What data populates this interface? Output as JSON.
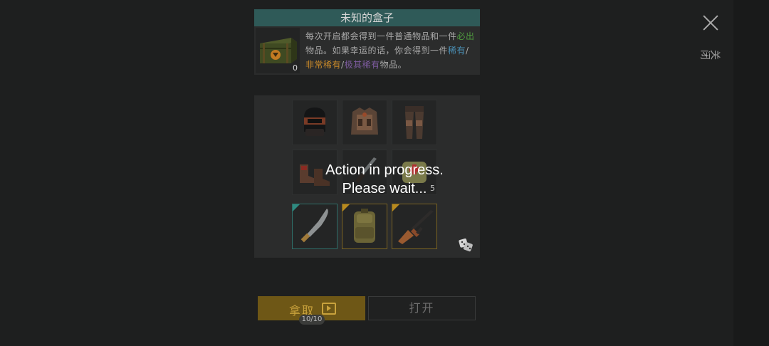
{
  "dialog": {
    "title": "未知的盒子",
    "chest_count": "0",
    "description": {
      "p1": "每次开启都会得到一件普通物品和一件",
      "must": "必出",
      "p2": "物品。如果幸运的话，你会得到一",
      "p3": "件",
      "rare": "稀有",
      "sep1": "/",
      "very_rare": "非常稀有",
      "sep2": "/",
      "extremely_rare": "极其稀有",
      "p4": "物品。"
    },
    "close_label": "关闭"
  },
  "items": [
    {
      "name": "helmet",
      "count": ""
    },
    {
      "name": "armored-vest",
      "count": ""
    },
    {
      "name": "armored-pants",
      "count": ""
    },
    {
      "name": "boots",
      "count": ""
    },
    {
      "name": "knife",
      "count": ""
    },
    {
      "name": "medical-bag",
      "count": "5"
    },
    {
      "name": "machete",
      "count": "",
      "rarity_color": "#2f8a80"
    },
    {
      "name": "tactical-backpack",
      "count": "",
      "rarity_color": "#b88a1f"
    },
    {
      "name": "assault-rifle",
      "count": "",
      "rarity_color": "#b88a1f"
    }
  ],
  "overlay": {
    "line1": "Action in progress.",
    "line2": "Please wait..."
  },
  "buttons": {
    "take_label": "拿取",
    "take_counter": "10/10",
    "open_label": "打开"
  },
  "colors": {
    "header": "#2f5a58",
    "take_button": "#6e5716",
    "must": "#4e9a3e",
    "rare": "#4a8fb5",
    "very_rare": "#c98a2a",
    "extremely_rare": "#7d5b9f"
  }
}
